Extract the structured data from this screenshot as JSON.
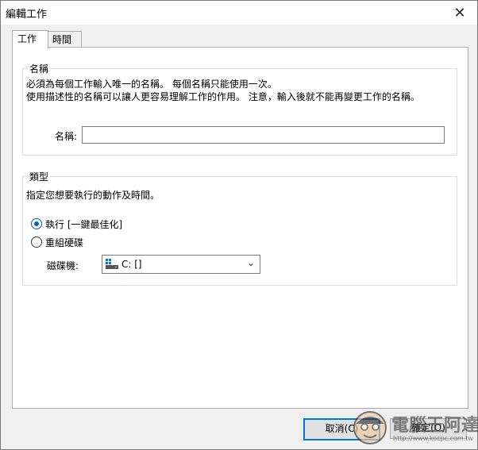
{
  "window": {
    "title": "編輯工作",
    "close_symbol": "✕"
  },
  "tabs": [
    {
      "label": "工作",
      "active": true
    },
    {
      "label": "時間",
      "active": false
    }
  ],
  "name_group": {
    "legend": "名稱",
    "description_line1": "必須為每個工作輸入唯一的名稱。 每個名稱只能使用一次。",
    "description_line2": "使用描述性的名稱可以讓人更容易理解工作的作用。 注意，輸入後就不能再變更工作的名稱。",
    "field_label": "名稱:",
    "field_value": ""
  },
  "type_group": {
    "legend": "類型",
    "description": "指定您想要執行的動作及時間。",
    "options": [
      {
        "label": "執行 [一鍵最佳化]",
        "checked": true
      },
      {
        "label": "重組硬碟",
        "checked": false
      }
    ],
    "drive_label": "磁碟機:",
    "drive_value": "C: []"
  },
  "buttons": {
    "cancel": "取消(C)",
    "ok": "確定(O)"
  },
  "watermark": {
    "text": "電腦王阿達",
    "url": "http://www.kocpc.com.tw"
  },
  "colors": {
    "accent": "#0078d7",
    "radio_checked": "#0063b1"
  }
}
